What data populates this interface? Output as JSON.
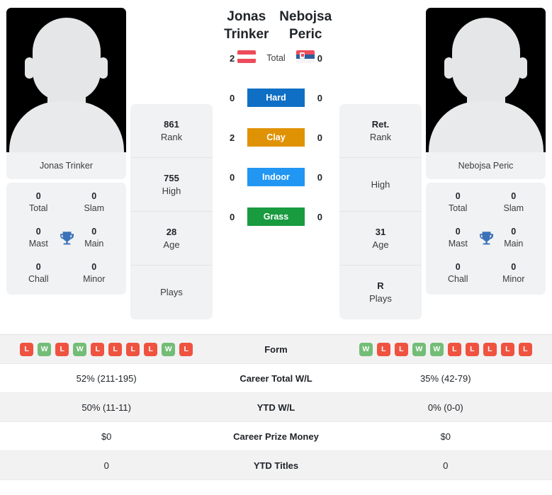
{
  "colors": {
    "hard": "#0e6fc4",
    "clay": "#e09205",
    "indoor": "#2196f3",
    "grass": "#199b3f",
    "win": "#73bd77",
    "loss": "#ef5340",
    "trophy": "#3c72b8"
  },
  "players": {
    "left": {
      "first_name": "Jonas",
      "last_name": "Trinker",
      "full_name": "Jonas Trinker",
      "flag": "austria-flag-icon",
      "awards": [
        {
          "value": "0",
          "label": "Total"
        },
        {
          "value": "0",
          "label": "Slam"
        },
        {
          "value": "0",
          "label": "Mast"
        },
        {
          "value": "0",
          "label": "Main"
        },
        {
          "value": "0",
          "label": "Chall"
        },
        {
          "value": "0",
          "label": "Minor"
        }
      ],
      "stats": [
        {
          "value": "861",
          "label": "Rank"
        },
        {
          "value": "755",
          "label": "High"
        },
        {
          "value": "28",
          "label": "Age"
        },
        {
          "value": "",
          "label": "Plays"
        }
      ],
      "form": [
        "L",
        "W",
        "L",
        "W",
        "L",
        "L",
        "L",
        "L",
        "W",
        "L"
      ],
      "career_total_wl": "52% (211-195)",
      "ytd_wl": "50% (11-11)",
      "career_prize_money": "$0",
      "ytd_titles": "0"
    },
    "right": {
      "first_name": "Nebojsa",
      "last_name": "Peric",
      "full_name": "Nebojsa Peric",
      "flag": "serbia-flag-icon",
      "awards": [
        {
          "value": "0",
          "label": "Total"
        },
        {
          "value": "0",
          "label": "Slam"
        },
        {
          "value": "0",
          "label": "Mast"
        },
        {
          "value": "0",
          "label": "Main"
        },
        {
          "value": "0",
          "label": "Chall"
        },
        {
          "value": "0",
          "label": "Minor"
        }
      ],
      "stats": [
        {
          "value": "Ret.",
          "label": "Rank"
        },
        {
          "value": "",
          "label": "High"
        },
        {
          "value": "31",
          "label": "Age"
        },
        {
          "value": "R",
          "label": "Plays"
        }
      ],
      "form": [
        "W",
        "L",
        "L",
        "W",
        "W",
        "L",
        "L",
        "L",
        "L",
        "L"
      ],
      "career_total_wl": "35% (42-79)",
      "ytd_wl": "0% (0-0)",
      "career_prize_money": "$0",
      "ytd_titles": "0"
    }
  },
  "head_to_head": [
    {
      "label": "Total",
      "left": "2",
      "right": "0",
      "style": "plain"
    },
    {
      "label": "Hard",
      "left": "0",
      "right": "0",
      "style": "hard"
    },
    {
      "label": "Clay",
      "left": "2",
      "right": "0",
      "style": "clay"
    },
    {
      "label": "Indoor",
      "left": "0",
      "right": "0",
      "style": "indoor"
    },
    {
      "label": "Grass",
      "left": "0",
      "right": "0",
      "style": "grass"
    }
  ],
  "table": {
    "form_label": "Form",
    "rows": [
      {
        "label": "Career Total W/L",
        "left": "52% (211-195)",
        "right": "35% (42-79)"
      },
      {
        "label": "YTD W/L",
        "left": "50% (11-11)",
        "right": "0% (0-0)"
      },
      {
        "label": "Career Prize Money",
        "left": "$0",
        "right": "$0"
      },
      {
        "label": "YTD Titles",
        "left": "0",
        "right": "0"
      }
    ]
  }
}
